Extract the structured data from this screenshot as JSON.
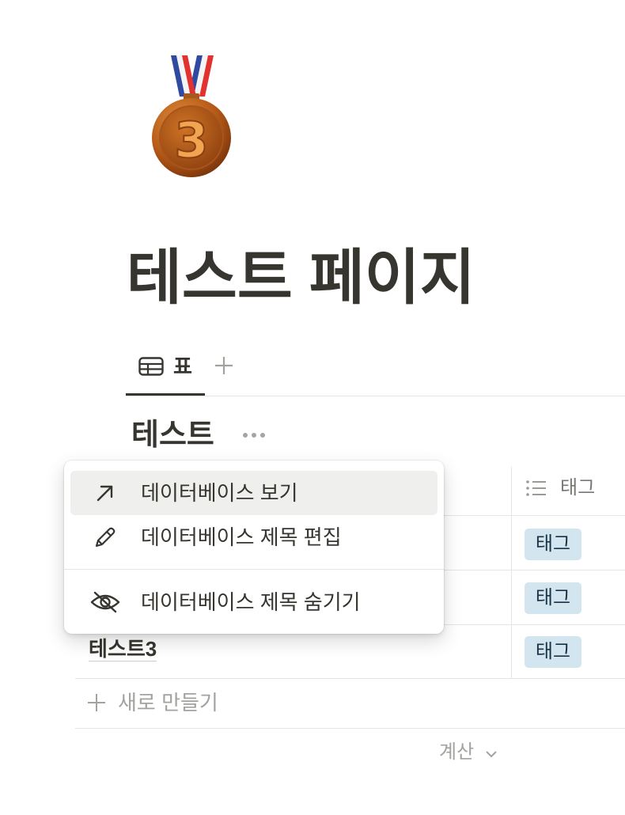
{
  "page": {
    "icon": "third-place-medal-icon",
    "icon_digit": "3",
    "title": "테스트 페이지"
  },
  "views": {
    "tabs": [
      {
        "label": "표",
        "icon": "table-icon",
        "active": true
      }
    ],
    "add_icon": "plus-icon"
  },
  "database": {
    "title": "테스트",
    "more_icon": "more-dots-icon",
    "columns": [
      {
        "label": "태그",
        "icon": "list-icon"
      }
    ],
    "rows": [
      {
        "tag": "태그"
      },
      {
        "tag": "태그"
      },
      {
        "name": "테스트3",
        "tag": "태그"
      }
    ],
    "new_row_label": "새로 만들기",
    "new_row_icon": "plus-icon",
    "calculate_label": "계산",
    "calculate_icon": "chevron-down-icon"
  },
  "menu": {
    "items": [
      {
        "label": "데이터베이스 보기",
        "icon": "arrow-up-right-icon",
        "highlighted": true
      },
      {
        "label": "데이터베이스 제목 편집",
        "icon": "pencil-icon",
        "highlighted": false
      },
      {
        "label": "데이터베이스 제목 숨기기",
        "icon": "eye-slash-icon",
        "highlighted": false
      }
    ]
  },
  "colors": {
    "text": "#37352f",
    "muted": "#9b9a97",
    "divider": "#e6e5e3",
    "tag_bg": "#d3e5ef",
    "tag_text": "#183347",
    "menu_highlight": "#efefee"
  }
}
